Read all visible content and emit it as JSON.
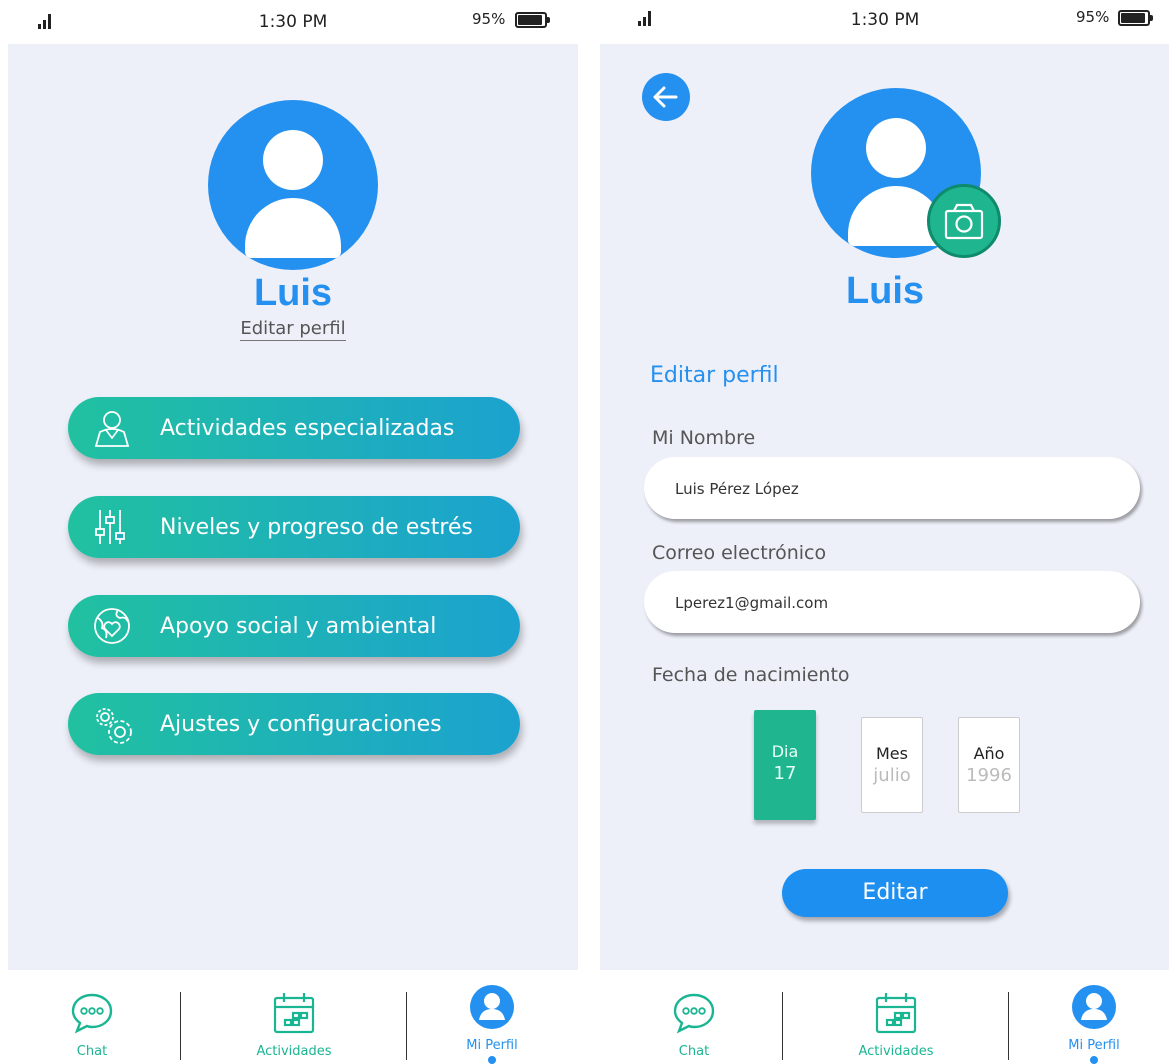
{
  "status_bar": {
    "time": "1:30 PM",
    "battery": "95%"
  },
  "colors": {
    "primary_blue": "#2490ef",
    "teal": "#1fb58f",
    "background": "#eef0f9"
  },
  "profile_screen": {
    "user_name": "Luis",
    "edit_profile_link": "Editar perfil",
    "menu": [
      {
        "label": "Actividades especializadas",
        "icon": "specialist-person-icon"
      },
      {
        "label": "Niveles y progreso de estrés",
        "icon": "sliders-icon"
      },
      {
        "label": "Apoyo social y ambiental",
        "icon": "globe-heart-icon"
      },
      {
        "label": "Ajustes y configuraciones",
        "icon": "gears-icon"
      }
    ]
  },
  "edit_screen": {
    "user_name": "Luis",
    "section_title": "Editar perfil",
    "name_label": "Mi Nombre",
    "name_value": "Luis Pérez López",
    "email_label": "Correo electrónico",
    "email_value": "Lperez1@gmail.com",
    "birth_label": "Fecha de nacimiento",
    "date": {
      "day": {
        "label": "Dia",
        "value": "17"
      },
      "month": {
        "label": "Mes",
        "value": "julio"
      },
      "year": {
        "label": "Año",
        "value": "1996"
      }
    },
    "submit_label": "Editar"
  },
  "bottom_nav": [
    {
      "label": "Chat",
      "icon": "chat-bubble-icon"
    },
    {
      "label": "Actividades",
      "icon": "calendar-icon"
    },
    {
      "label": "Mi Perfil",
      "icon": "profile-icon",
      "active": true
    }
  ]
}
